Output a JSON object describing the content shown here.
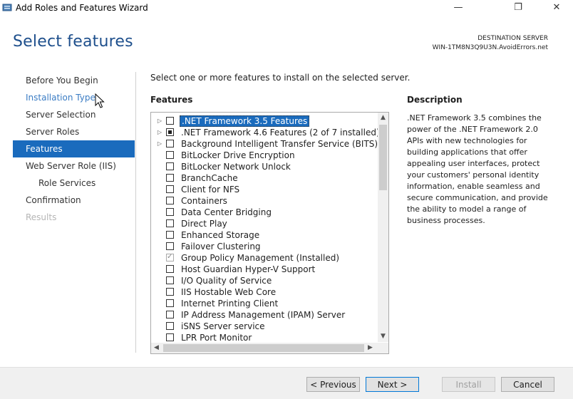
{
  "window": {
    "title": "Add Roles and Features Wizard",
    "controls": {
      "minimize": "—",
      "maximize": "❐",
      "close": "✕"
    }
  },
  "page": {
    "title": "Select features"
  },
  "destination": {
    "label": "DESTINATION SERVER",
    "server": "WIN-1TM8N3Q9U3N.AvoidErrors.net"
  },
  "nav": {
    "items": [
      {
        "label": "Before You Begin",
        "state": "normal"
      },
      {
        "label": "Installation Type",
        "state": "link"
      },
      {
        "label": "Server Selection",
        "state": "normal"
      },
      {
        "label": "Server Roles",
        "state": "normal"
      },
      {
        "label": "Features",
        "state": "active"
      },
      {
        "label": "Web Server Role (IIS)",
        "state": "normal"
      },
      {
        "label": "Role Services",
        "state": "sub"
      },
      {
        "label": "Confirmation",
        "state": "normal"
      },
      {
        "label": "Results",
        "state": "disabled"
      }
    ]
  },
  "main": {
    "instruction": "Select one or more features to install on the selected server.",
    "features_header": "Features",
    "features": [
      {
        "label": ".NET Framework 3.5 Features",
        "expandable": true,
        "check": "unchecked",
        "selected": true
      },
      {
        "label": ".NET Framework 4.6 Features (2 of 7 installed)",
        "expandable": true,
        "check": "partial",
        "selected": false
      },
      {
        "label": "Background Intelligent Transfer Service (BITS)",
        "expandable": true,
        "check": "unchecked",
        "selected": false
      },
      {
        "label": "BitLocker Drive Encryption",
        "expandable": false,
        "check": "unchecked",
        "selected": false
      },
      {
        "label": "BitLocker Network Unlock",
        "expandable": false,
        "check": "unchecked",
        "selected": false
      },
      {
        "label": "BranchCache",
        "expandable": false,
        "check": "unchecked",
        "selected": false
      },
      {
        "label": "Client for NFS",
        "expandable": false,
        "check": "unchecked",
        "selected": false
      },
      {
        "label": "Containers",
        "expandable": false,
        "check": "unchecked",
        "selected": false
      },
      {
        "label": "Data Center Bridging",
        "expandable": false,
        "check": "unchecked",
        "selected": false
      },
      {
        "label": "Direct Play",
        "expandable": false,
        "check": "unchecked",
        "selected": false
      },
      {
        "label": "Enhanced Storage",
        "expandable": false,
        "check": "unchecked",
        "selected": false
      },
      {
        "label": "Failover Clustering",
        "expandable": false,
        "check": "unchecked",
        "selected": false
      },
      {
        "label": "Group Policy Management (Installed)",
        "expandable": false,
        "check": "installed",
        "selected": false
      },
      {
        "label": "Host Guardian Hyper-V Support",
        "expandable": false,
        "check": "unchecked",
        "selected": false
      },
      {
        "label": "I/O Quality of Service",
        "expandable": false,
        "check": "unchecked",
        "selected": false
      },
      {
        "label": "IIS Hostable Web Core",
        "expandable": false,
        "check": "unchecked",
        "selected": false
      },
      {
        "label": "Internet Printing Client",
        "expandable": false,
        "check": "unchecked",
        "selected": false
      },
      {
        "label": "IP Address Management (IPAM) Server",
        "expandable": false,
        "check": "unchecked",
        "selected": false
      },
      {
        "label": "iSNS Server service",
        "expandable": false,
        "check": "unchecked",
        "selected": false
      },
      {
        "label": "LPR Port Monitor",
        "expandable": false,
        "check": "unchecked",
        "selected": false
      }
    ]
  },
  "description": {
    "header": "Description",
    "text": ".NET Framework 3.5 combines the power of the .NET Framework 2.0 APIs with new technologies for building applications that offer appealing user interfaces, protect your customers' personal identity information, enable seamless and secure communication, and provide the ability to model a range of business processes."
  },
  "footer": {
    "previous": "< Previous",
    "next": "Next >",
    "install": "Install",
    "cancel": "Cancel"
  },
  "icons": {
    "expander": "▷",
    "scroll_up": "▲",
    "scroll_down": "▼",
    "scroll_left": "◀",
    "scroll_right": "▶"
  }
}
